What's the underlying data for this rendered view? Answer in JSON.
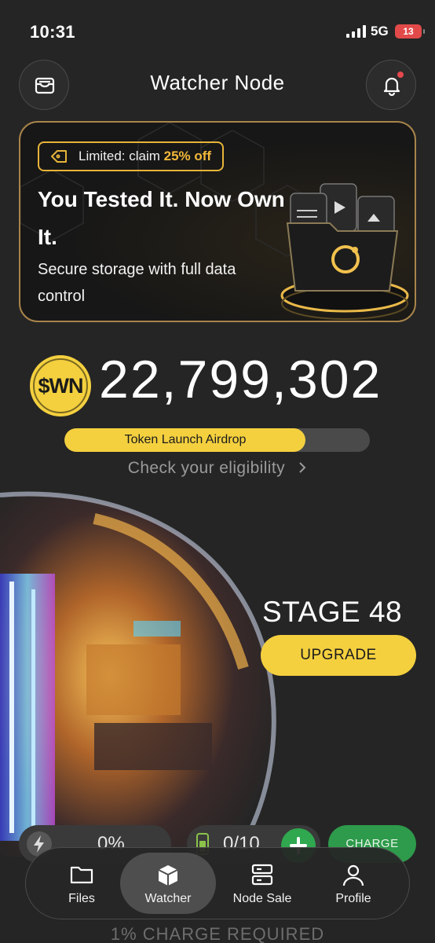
{
  "status": {
    "time": "10:31",
    "network": "5G",
    "battery": "13"
  },
  "header": {
    "title": "Watcher Node",
    "left_icon": "wallet-icon",
    "right_icon": "bell-icon",
    "notification": true
  },
  "promo": {
    "badge_prefix": "Limited: claim ",
    "badge_highlight": "25% off",
    "title": "You Tested It. Now Own It.",
    "subtitle": "Secure storage with full data control",
    "accent": "#f3b93a"
  },
  "balance": {
    "coin_label": "$WN",
    "amount": "22,799,302"
  },
  "airdrop": {
    "label": "Token Launch Airdrop",
    "progress": 0.79,
    "link": "Check your eligibility"
  },
  "node": {
    "stage": "STAGE 48",
    "upgrade_label": "UPGRADE"
  },
  "charge": {
    "percent": "0%",
    "batteries": "0/10",
    "button_label": "CHARGE",
    "requirement": "1% CHARGE REQUIRED"
  },
  "tabs": [
    {
      "label": "Files",
      "icon": "folder-icon",
      "active": false
    },
    {
      "label": "Watcher",
      "icon": "cube-icon",
      "active": true
    },
    {
      "label": "Node Sale",
      "icon": "server-icon",
      "active": false
    },
    {
      "label": "Profile",
      "icon": "person-icon",
      "active": false
    }
  ],
  "colors": {
    "background": "#252525",
    "yellow": "#f4d03f",
    "green": "#2e9a4b"
  }
}
